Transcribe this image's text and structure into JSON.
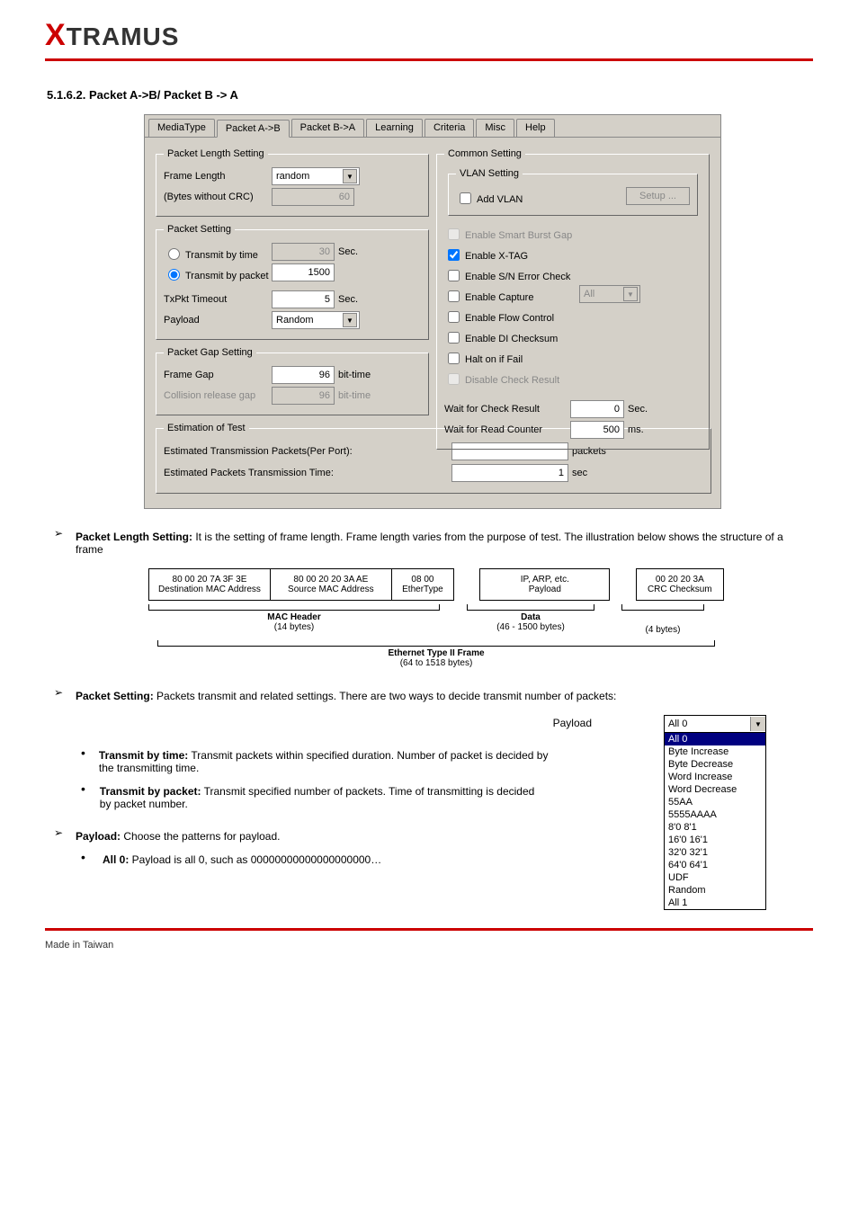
{
  "logo_prefix": "X",
  "logo_rest": "TRAMUS",
  "section_heading": "5.1.6.2. Packet A->B/ Packet B -> A",
  "tabs": [
    "MediaType",
    "Packet A->B",
    "Packet B->A",
    "Learning",
    "Criteria",
    "Misc",
    "Help"
  ],
  "active_tab_index": 1,
  "groups": {
    "pkt_len": "Packet Length Setting",
    "pkt_set": "Packet Setting",
    "pkt_gap": "Packet Gap Setting",
    "est": "Estimation of Test",
    "common": "Common Setting",
    "vlan": "VLAN Setting"
  },
  "labels": {
    "frame_length": "Frame Length",
    "bytes_no_crc": "(Bytes without CRC)",
    "transmit_time": "Transmit by time",
    "transmit_pkt": "Transmit by packet",
    "txpkt_timeout": "TxPkt Timeout",
    "payload": "Payload",
    "frame_gap": "Frame Gap",
    "collision": "Collision release gap",
    "est_pkts": "Estimated Transmission Packets(Per Port):",
    "est_time": "Estimated Packets Transmission Time:",
    "add_vlan": "Add VLAN",
    "setup": "Setup ...",
    "en_smart": "Enable Smart Burst Gap",
    "en_xtag": "Enable X-TAG",
    "en_sn": "Enable S/N Error Check",
    "en_cap": "Enable Capture",
    "en_flow": "Enable Flow Control",
    "en_di": "Enable DI Checksum",
    "halt": "Halt on if Fail",
    "dis_check": "Disable Check Result",
    "wait_check": "Wait for Check Result",
    "wait_read": "Wait for Read Counter",
    "unit_sec": "Sec.",
    "unit_bittime": "bit-time",
    "unit_packets": "packets",
    "unit_secL": "sec",
    "unit_ms": "ms."
  },
  "values": {
    "frame_length_sel": "random",
    "frame_length_num": "60",
    "transmit_time_val": "30",
    "transmit_pkt_val": "1500",
    "txpkt_timeout_val": "5",
    "payload_sel": "Random",
    "frame_gap_val": "96",
    "collision_val": "96",
    "est_pkts_val": "",
    "est_time_val": "1",
    "cap_sel": "All",
    "wait_check_val": "0",
    "wait_read_val": "500"
  },
  "checks": {
    "transmit_time": false,
    "transmit_pkt": true,
    "add_vlan": false,
    "en_smart": false,
    "en_xtag": true,
    "en_sn": false,
    "en_cap": false,
    "en_flow": false,
    "en_di": false,
    "halt": false,
    "dis_check": false
  },
  "bullet1_strong": "Packet Length Setting:",
  "bullet1_text": "It is the setting of frame length. Frame length varies from the purpose of test. The illustration below shows the structure of a frame",
  "diagram": {
    "dest_hex": "80 00 20 7A 3F 3E",
    "dest_lbl": "Destination MAC Address",
    "src_hex": "80 00 20 20 3A AE",
    "src_lbl": "Source MAC Address",
    "eth_hex": "08 00",
    "eth_lbl": "EtherType",
    "pay_top": "IP, ARP, etc.",
    "pay_lbl": "Payload",
    "crc_hex": "00 20 20 3A",
    "crc_lbl": "CRC Checksum",
    "mac_hdr": "MAC Header",
    "mac_sub": "(14 bytes)",
    "data_hdr": "Data",
    "data_sub": "(46 - 1500 bytes)",
    "crc_sub": "(4 bytes)",
    "frame_title": "Ethernet Type II Frame",
    "frame_sub": "(64 to 1518 bytes)"
  },
  "bullet2_strong": "Packet Setting:",
  "bullet2_text": " Packets transmit and related settings. There are two ways to decide transmit number of packets:",
  "sub_time_strong": "Transmit by time:",
  "sub_time_text": " Transmit packets within specified duration. Number of packet is decided by the transmitting time.",
  "sub_pkt_strong": "Transmit by packet:",
  "sub_pkt_text": " Transmit specified number of packets. Time of transmitting is decided by packet number.",
  "bullet3_strong": "Payload:",
  "bullet3_text": " Choose the patterns for payload.",
  "sub_all0_strong": "All 0:",
  "sub_all0_text": " Payload is all 0, such as 00000000000000000000…",
  "payload_dd_label": "Payload",
  "payload_dd_top": "All 0",
  "payload_options": [
    "All 0",
    "Byte Increase",
    "Byte Decrease",
    "Word Increase",
    "Word Decrease",
    "55AA",
    "5555AAAA",
    "8'0 8'1",
    "16'0 16'1",
    "32'0 32'1",
    "64'0 64'1",
    "UDF",
    "Random",
    "All 1"
  ],
  "footer": "Made in Taiwan"
}
